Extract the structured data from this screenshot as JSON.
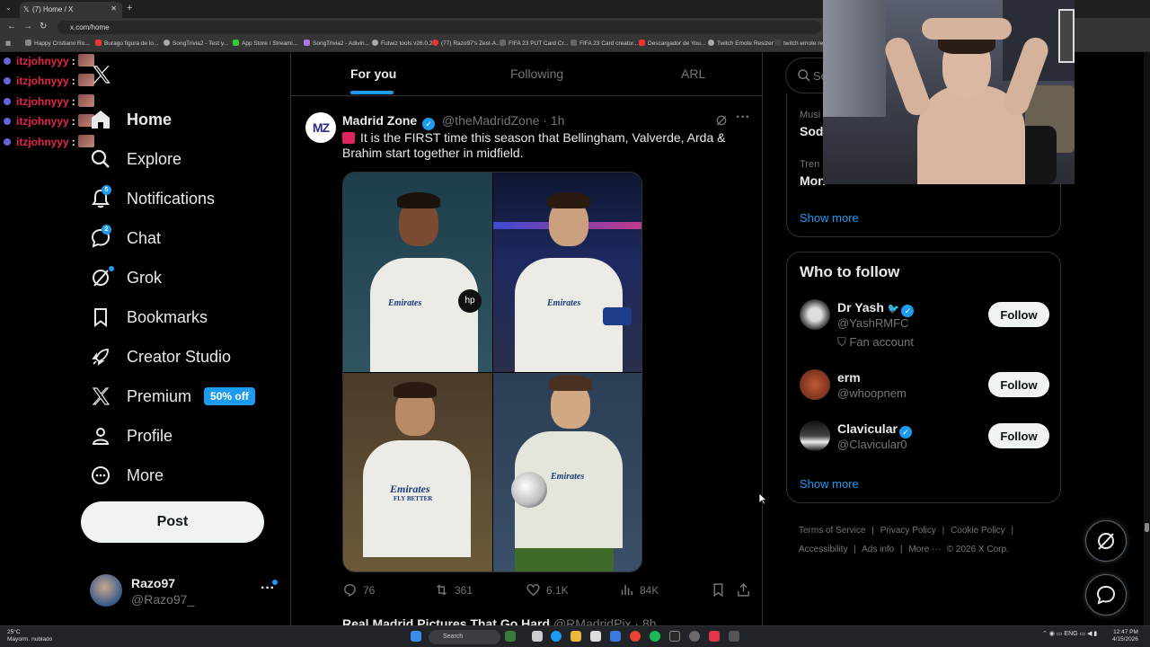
{
  "browser": {
    "tab_title": "(7) Home / X",
    "url": "x.com/home",
    "bookmarks": [
      "Happy Cristiano Ro...",
      "Burago figura de lo...",
      "SongTrivia2 - Test y...",
      "App Store / Streami...",
      "SongTrivia2 - Adivin...",
      "Futwiz tools v26.0.28",
      "(77) Razo97's Zest-A...",
      "FIFA 23 PUT Card Cr...",
      "FIFA 23 Card creator...",
      "Descargador de You...",
      "Twitch Emote Resizer",
      "twitch emote re..."
    ]
  },
  "stream_chat": {
    "username": "itzjohnyyy",
    "separator": ":",
    "line_count": 5
  },
  "nav": {
    "home": "Home",
    "explore": "Explore",
    "notifications": "Notifications",
    "notifications_badge": "5",
    "chat": "Chat",
    "chat_badge": "2",
    "grok": "Grok",
    "bookmarks": "Bookmarks",
    "creator_studio": "Creator Studio",
    "premium": "Premium",
    "premium_badge": "50% off",
    "profile": "Profile",
    "more": "More",
    "post_button": "Post"
  },
  "account": {
    "name": "Razo97",
    "handle": "@Razo97_"
  },
  "feed": {
    "tabs": [
      "For you",
      "Following",
      "ARL"
    ],
    "active_tab": "For you",
    "tweet": {
      "avatar_text": "MZ",
      "name": "Madrid Zone",
      "handle": "@theMadridZone",
      "separator": "·",
      "time": "1h",
      "text": "It is the FIRST time this season that Bellingham, Valverde, Arda & Brahim start together in midfield.",
      "replies": "76",
      "reposts": "361",
      "likes": "6.1K",
      "views": "84K",
      "jersey_text_1": "Emirates",
      "jersey_text_2": "FLY BETTER"
    },
    "next_tweet": {
      "name": "Real Madrid Pictures That Go Hard",
      "handle": "@RMadridPix · 8h"
    }
  },
  "right": {
    "search_placeholder": "Se",
    "trend_1_category": "Musi",
    "trend_1_name": "Sod",
    "trend_2_category": "Tren",
    "trend_2_name": "Mon",
    "show_more": "Show more",
    "who_to_follow": {
      "title": "Who to follow",
      "users": [
        {
          "name": "Dr Yash",
          "handle": "@YashRMFC",
          "extra": "Fan account",
          "button": "Follow"
        },
        {
          "name": "erm",
          "handle": "@whoopnem",
          "extra": "",
          "button": "Follow"
        },
        {
          "name": "Clavicular",
          "handle": "@Clavicular0",
          "extra": "",
          "button": "Follow"
        }
      ],
      "show_more": "Show more"
    },
    "footer": [
      "Terms of Service",
      "|",
      "Privacy Policy",
      "|",
      "Cookie Policy",
      "|",
      "Accessibility",
      "|",
      "Ads info",
      "|",
      "More ···",
      "© 2026 X Corp."
    ]
  },
  "taskbar": {
    "weather_temp": "25°C",
    "weather_desc": "Mayorm. nublado",
    "search": "Search",
    "lang": "ENG",
    "time": "12:47 PM",
    "date": "4/15/2026"
  },
  "colors": {
    "accent": "#1d9bf0",
    "background": "#000000",
    "border": "#2f3336",
    "muted_text": "#71767b",
    "chat_user": "#e5234a"
  }
}
